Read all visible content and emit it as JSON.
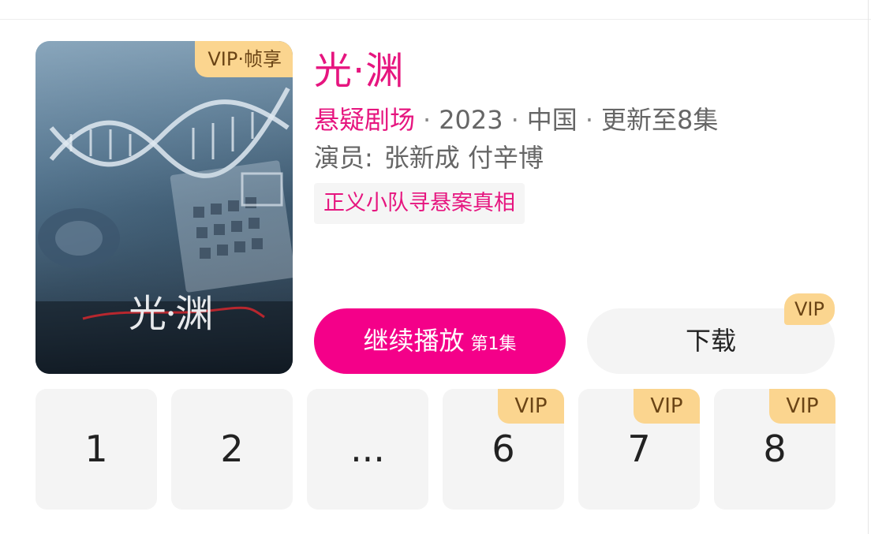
{
  "show": {
    "title": "光·渊",
    "poster_badge": "VIP·帧享",
    "poster_caption": "光·渊",
    "genre": "悬疑剧场",
    "year": "2023",
    "region": "中国",
    "update_status": "更新至8集",
    "separator": "·",
    "cast_label": "演员:",
    "cast": "张新成 付辛博",
    "tag": "正义小队寻悬案真相"
  },
  "actions": {
    "play_label": "继续播放",
    "play_episode": "第1集",
    "download_label": "下载",
    "download_badge": "VIP"
  },
  "episodes": [
    {
      "label": "1",
      "vip": ""
    },
    {
      "label": "2",
      "vip": ""
    },
    {
      "label": "...",
      "vip": ""
    },
    {
      "label": "6",
      "vip": "VIP"
    },
    {
      "label": "7",
      "vip": "VIP"
    },
    {
      "label": "8",
      "vip": "VIP"
    }
  ],
  "colors": {
    "accent": "#e6157f",
    "play_button": "#f40089",
    "vip_badge": "#fbd58f",
    "vip_text": "#6a4415",
    "tile_background": "#f4f4f4"
  }
}
